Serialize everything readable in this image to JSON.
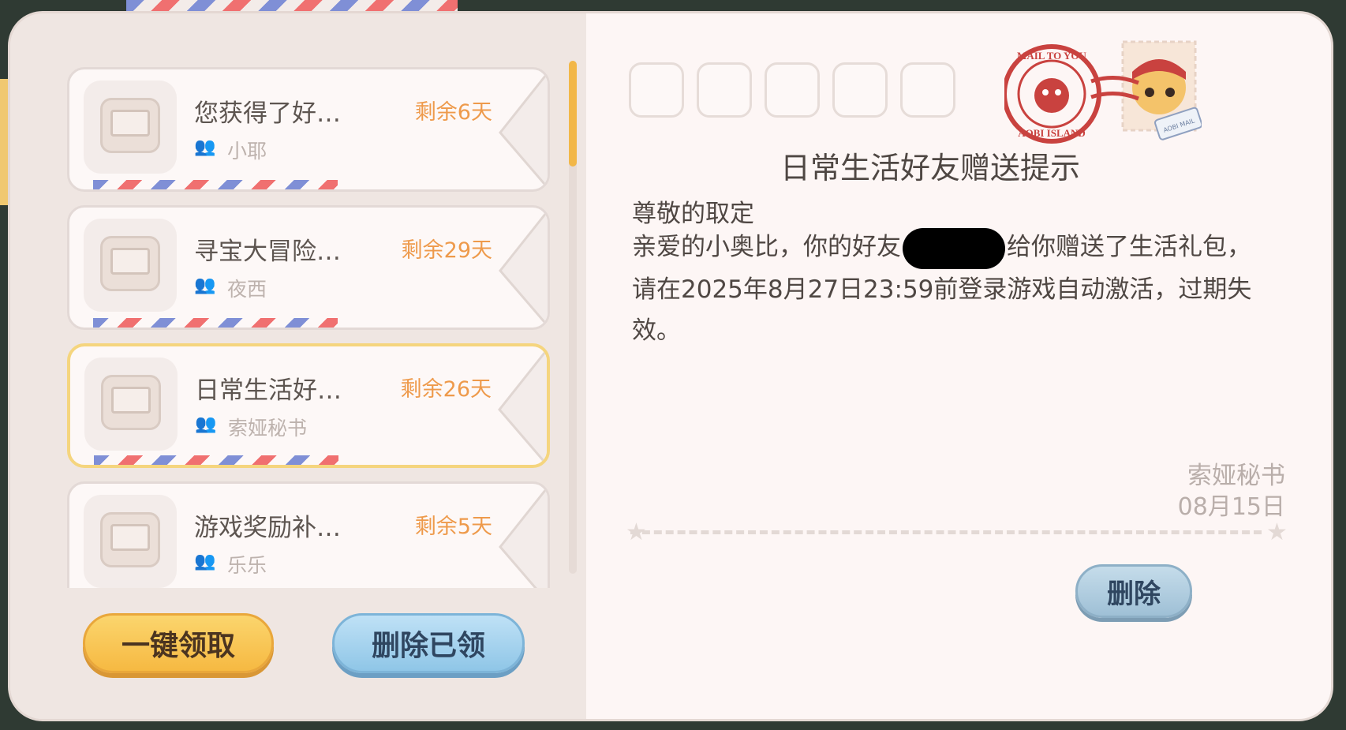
{
  "mail_list": [
    {
      "title": "您获得了好…",
      "remain": "剩余6天",
      "sender": "小耶",
      "selected": false
    },
    {
      "title": "寻宝大冒险…",
      "remain": "剩余29天",
      "sender": "夜西",
      "selected": false
    },
    {
      "title": "日常生活好…",
      "remain": "剩余26天",
      "sender": "索娅秘书",
      "selected": true
    },
    {
      "title": "游戏奖励补…",
      "remain": "剩余5天",
      "sender": "乐乐",
      "selected": false
    }
  ],
  "buttons": {
    "claim_all": "一键领取",
    "delete_claimed": "删除已领",
    "delete": "删除"
  },
  "detail": {
    "title": "日常生活好友赠送提示",
    "greeting": "尊敬的取定",
    "body_before": "亲爱的小奥比，你的好友",
    "body_after": "给你赠送了生活礼包，请在2025年8月27日23:59前登录游戏自动激活，过期失效。",
    "signature": "索娅秘书",
    "date": "08月15日"
  },
  "stamp": {
    "top_text": "MAIL TO YOU",
    "bottom_text": "AOBI ISLAND",
    "tag": "AOBI MAIL"
  },
  "colors": {
    "accent_orange": "#ee9a4b",
    "selected_border": "#f5d57e",
    "scroll_thumb": "#f2b748"
  }
}
